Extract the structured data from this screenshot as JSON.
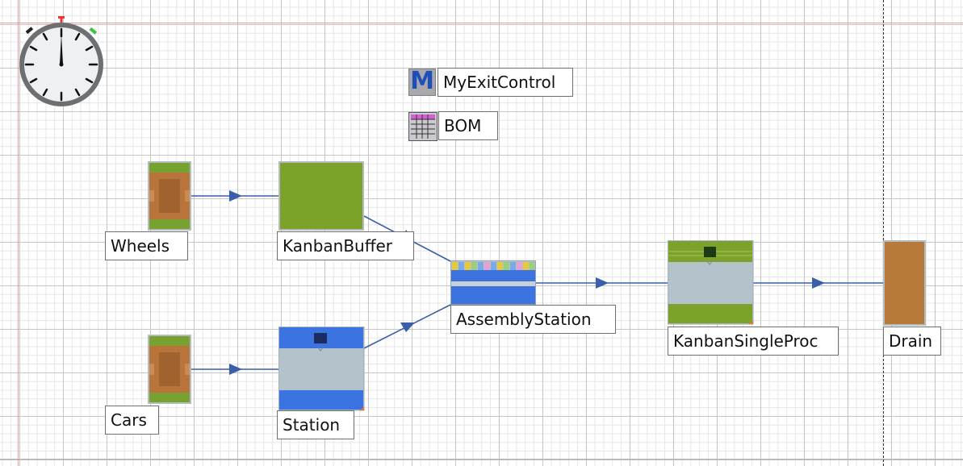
{
  "objects": {
    "wheels": "Wheels",
    "cars": "Cars",
    "kanban_buffer": "KanbanBuffer",
    "station": "Station",
    "assembly_station": "AssemblyStation",
    "kanban_single_proc": "KanbanSingleProc",
    "drain": "Drain",
    "method": "MyExitControl",
    "method_icon_letter": "M",
    "table": "BOM"
  },
  "colors": {
    "source_green": "#78a22f",
    "source_brown": "#b8743a",
    "buffer_green": "#7da22c",
    "station_blue": "#3b74e0",
    "station_gray": "#b3c2cb",
    "drain_brown": "#b87a3a",
    "connector": "#3a5fa8",
    "method_blue": "#1e4fb7",
    "frame_red": "#ef9a9a"
  },
  "icons": {
    "clock": "event-controller-clock-icon",
    "method": "method-icon",
    "table": "table-icon"
  }
}
